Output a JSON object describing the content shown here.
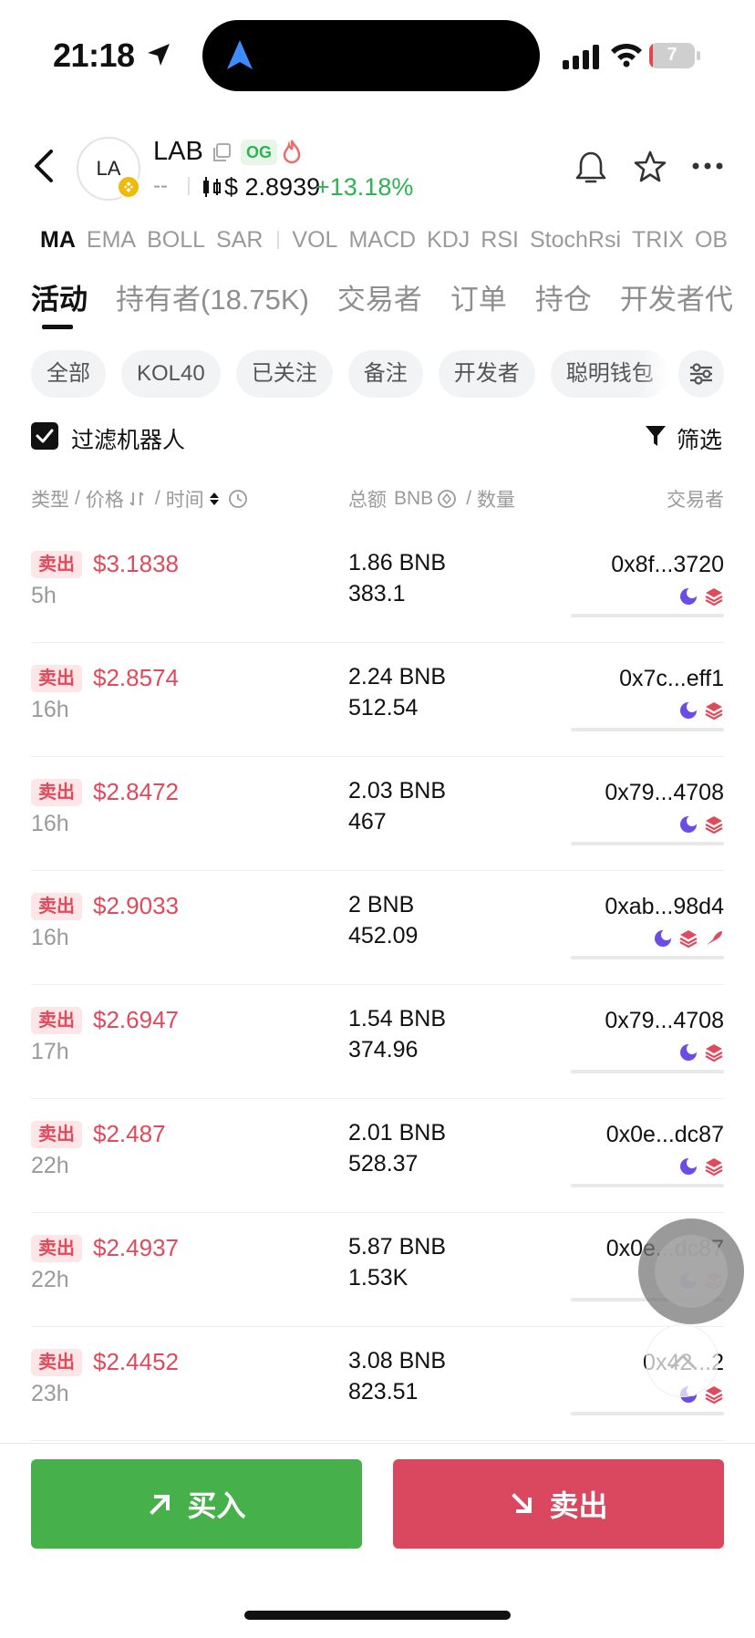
{
  "status_bar": {
    "time": "21:18",
    "battery": "7",
    "battery_level_percent": 7,
    "battery_color": "#e6464f"
  },
  "header": {
    "avatar_text": "LA",
    "token_name": "LAB",
    "badge": "OG",
    "placeholder": "--",
    "price": "$ 2.8939",
    "change": "+13.18%",
    "change_color": "#2fb252"
  },
  "indicators": {
    "main": [
      "MA",
      "EMA",
      "BOLL",
      "SAR"
    ],
    "sub": [
      "VOL",
      "MACD",
      "KDJ",
      "RSI",
      "StochRsi",
      "TRIX",
      "OB"
    ]
  },
  "tabs": [
    "活动",
    "持有者(18.75K)",
    "交易者",
    "订单",
    "持仓",
    "开发者代"
  ],
  "chips": [
    "全部",
    "KOL40",
    "已关注",
    "备注",
    "开发者",
    "聪明钱包"
  ],
  "filter": {
    "label": "过滤机器人",
    "button": "筛选",
    "checked": true
  },
  "columns": {
    "type_price_time": [
      "类型",
      "价格",
      "时间"
    ],
    "total_qty": [
      "总额",
      "BNB",
      "数量"
    ],
    "trader": "交易者",
    "sep": "/"
  },
  "trades": [
    {
      "type": "卖出",
      "price": "$3.1838",
      "time": "5h",
      "total": "1.86 BNB",
      "qty": "383.1",
      "trader": "0x8f...3720",
      "icons": [
        "moon",
        "stack"
      ]
    },
    {
      "type": "卖出",
      "price": "$2.8574",
      "time": "16h",
      "total": "2.24 BNB",
      "qty": "512.54",
      "trader": "0x7c...eff1",
      "icons": [
        "moon",
        "stack"
      ]
    },
    {
      "type": "卖出",
      "price": "$2.8472",
      "time": "16h",
      "total": "2.03 BNB",
      "qty": "467",
      "trader": "0x79...4708",
      "icons": [
        "moon",
        "stack"
      ]
    },
    {
      "type": "卖出",
      "price": "$2.9033",
      "time": "16h",
      "total": "2 BNB",
      "qty": "452.09",
      "trader": "0xab...98d4",
      "icons": [
        "moon",
        "stack",
        "fish"
      ]
    },
    {
      "type": "卖出",
      "price": "$2.6947",
      "time": "17h",
      "total": "1.54 BNB",
      "qty": "374.96",
      "trader": "0x79...4708",
      "icons": [
        "moon",
        "stack"
      ]
    },
    {
      "type": "卖出",
      "price": "$2.487",
      "time": "22h",
      "total": "2.01 BNB",
      "qty": "528.37",
      "trader": "0x0e...dc87",
      "icons": [
        "moon",
        "stack"
      ]
    },
    {
      "type": "卖出",
      "price": "$2.4937",
      "time": "22h",
      "total": "5.87 BNB",
      "qty": "1.53K",
      "trader": "0x0e...dc87",
      "icons": [
        "moon",
        "stack"
      ]
    },
    {
      "type": "卖出",
      "price": "$2.4452",
      "time": "23h",
      "total": "3.08 BNB",
      "qty": "823.51",
      "trader": "0x42...2",
      "icons": [
        "moon",
        "stack"
      ]
    }
  ],
  "actions": {
    "buy": "买入",
    "sell": "卖出",
    "buy_color": "#46b04a",
    "sell_color": "#d9485e"
  },
  "colors": {
    "sell_red": "#e04a5b",
    "icon_purple": "#6b4de6",
    "icon_red": "#e04a5b"
  }
}
